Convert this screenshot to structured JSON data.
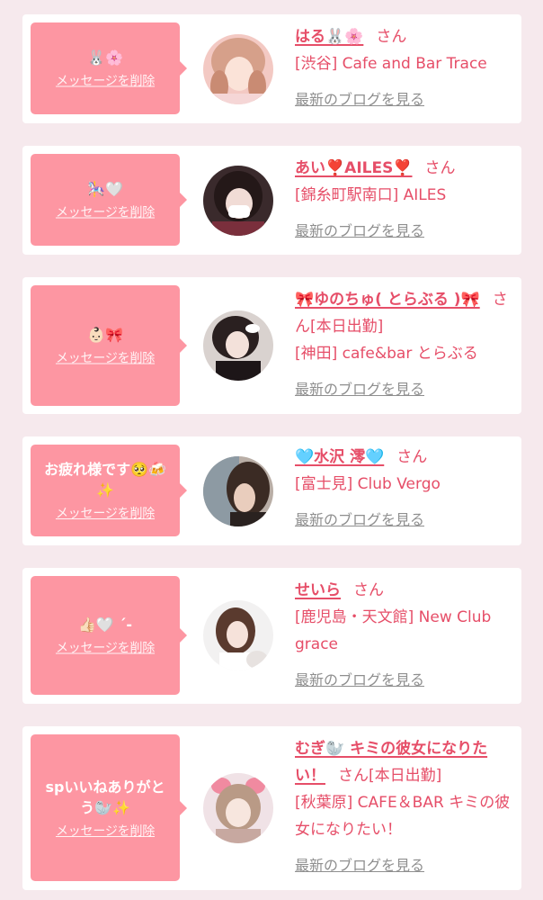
{
  "delete_label": "メッセージを削除",
  "blog_label": "最新のブログを見る",
  "san_label": "さん",
  "cards": [
    {
      "message": "🐰🌸",
      "name": "はる🐰🌸",
      "status": "",
      "shop": "[渋谷] Cafe and Bar Trace"
    },
    {
      "message": "🎠🤍",
      "name": "あい❣️AILES❣️",
      "status": "",
      "shop": "[錦糸町駅南口] AILES"
    },
    {
      "message": "👶🏻🎀",
      "name": "🎀ゆのちゅ( とらぶる )🎀",
      "status": "[本日出勤]",
      "shop": "[神田] cafe&bar とらぶる"
    },
    {
      "message": "お疲れ様です🥺🍻✨",
      "name": "🩵水沢 澪🩵",
      "status": "",
      "shop": "[富士見] Club Vergo"
    },
    {
      "message": "👍🏻🤍 ˊ-",
      "name": "せいら",
      "status": "",
      "shop": "[鹿児島・天文館] New Club grace"
    },
    {
      "message": "spいいねありがとう🦭✨",
      "name": "むぎ🦭 キミの彼女になりたい！",
      "status": "[本日出勤]",
      "shop": "[秋葉原] CAFE＆BAR キミの彼女になりたい！"
    }
  ],
  "colors": {
    "page_bg": "#f6e9ed",
    "bubble_bg": "#fd96a2",
    "accent_text": "#e64e68",
    "link_gray": "#8f8f8f"
  }
}
